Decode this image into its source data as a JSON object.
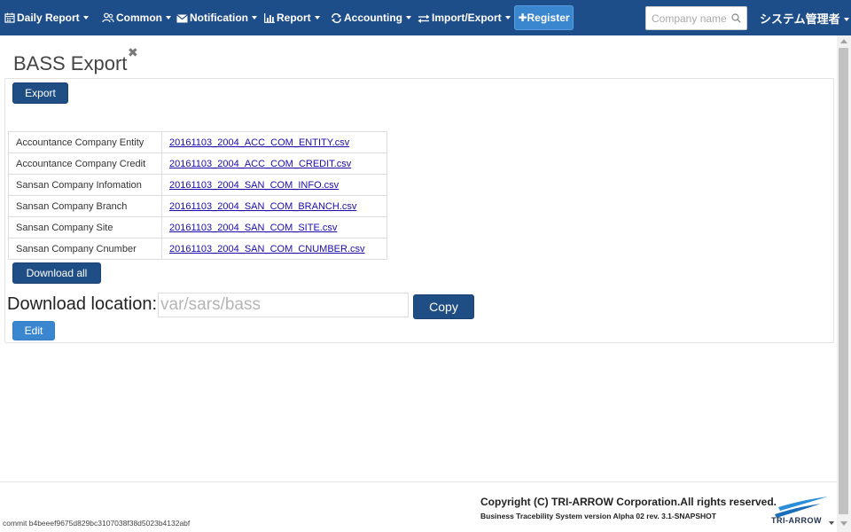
{
  "navbar": {
    "items": [
      {
        "label": "Daily Report",
        "icon": "calendar-icon"
      },
      {
        "label": "Common",
        "icon": "users-icon"
      },
      {
        "label": "Notification",
        "icon": "envelope-icon"
      },
      {
        "label": "Report",
        "icon": "bar-chart-icon"
      },
      {
        "label": "Accounting",
        "icon": "exchange-icon"
      },
      {
        "label": "Import/Export",
        "icon": "transfer-icon"
      }
    ],
    "register_label": "Register",
    "search": {
      "placeholder": "Company name",
      "value": ""
    },
    "user_label": "システム管理者"
  },
  "page": {
    "title": "BASS Export",
    "close_glyph": "✖",
    "export_button": "Export",
    "files": [
      {
        "name": "Accountance Company Entity",
        "file": "20161103_2004_ACC_COM_ENTITY.csv"
      },
      {
        "name": "Accountance Company Credit",
        "file": "20161103_2004_ACC_COM_CREDIT.csv"
      },
      {
        "name": "Sansan Company Infomation",
        "file": "20161103_2004_SAN_COM_INFO.csv"
      },
      {
        "name": "Sansan Company Branch",
        "file": "20161103_2004_SAN_COM_BRANCH.csv"
      },
      {
        "name": "Sansan Company Site",
        "file": "20161103_2004_SAN_COM_SITE.csv"
      },
      {
        "name": "Sansan Company Cnumber",
        "file": "20161103_2004_SAN_COM_CNUMBER.csv"
      }
    ],
    "download_all_button": "Download all",
    "download_location_label": "Download location:",
    "download_location_placeholder": "var/sars/bass",
    "copy_button": "Copy",
    "edit_button": "Edit"
  },
  "footer": {
    "copyright": "Copyright (C) TRI-ARROW Corporation.All rights reserved.",
    "version": "Business Tracebility System version Alpha 02 rev. 3.1-SNAPSHOT",
    "commit": "commit b4beeef9675d829bc3107038f38d5023b4132abf",
    "logo_text": "TRI-ARROW"
  },
  "colors": {
    "navbar_bg": "#1e4e8a",
    "primary_button": "#1f4e85",
    "register_button": "#3a87d0",
    "link": "#1a0dab"
  }
}
